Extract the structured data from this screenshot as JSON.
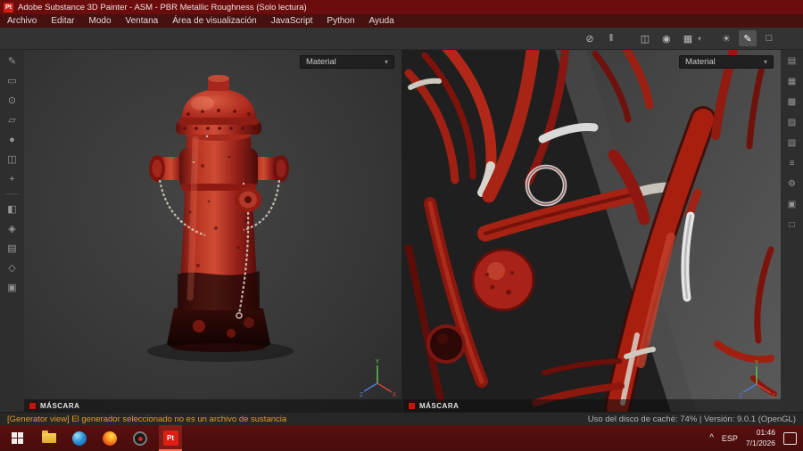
{
  "window": {
    "app_icon": "Pt",
    "title": "Adobe Substance 3D Painter - ASM - PBR Metallic Roughness (Solo lectura)"
  },
  "menubar": {
    "items": [
      "Archivo",
      "Editar",
      "Modo",
      "Ventana",
      "Área de visualización",
      "JavaScript",
      "Python",
      "Ayuda"
    ]
  },
  "top_toolbar": {
    "caret": "▾",
    "icons": [
      {
        "name": "toggle-visibility",
        "glyph": "⊘"
      },
      {
        "name": "pause",
        "glyph": "‖"
      },
      {
        "name": "viewport-layout",
        "glyph": "◫"
      },
      {
        "name": "material-sphere",
        "glyph": "◉"
      },
      {
        "name": "camera-view",
        "glyph": "▦"
      },
      {
        "name": "environment-light",
        "glyph": "☀"
      },
      {
        "name": "paint-mode",
        "glyph": "✎"
      },
      {
        "name": "capture",
        "glyph": "□"
      }
    ]
  },
  "left_toolbar": {
    "tools": [
      "✎",
      "▭",
      "⊙",
      "▱",
      "●",
      "◫",
      "+"
    ],
    "panels": [
      "◧",
      "◈",
      "▤",
      "◇",
      "▣"
    ]
  },
  "right_toolbar": {
    "icons": [
      "▤",
      "▦",
      "▩",
      "▨",
      "▧",
      "≡",
      "⚙",
      "▣",
      "□"
    ]
  },
  "viewport_3d": {
    "material_selector": "Material",
    "mask_label": "MÁSCARA",
    "gizmo": {
      "x": "X",
      "y": "Y",
      "z": "Z"
    }
  },
  "viewport_2d": {
    "material_selector": "Material",
    "mask_label": "MÁSCARA",
    "gizmo": {
      "x": "X",
      "y": "Y",
      "z": "Z"
    }
  },
  "status_bar": {
    "message": "[Generator view] El generador seleccionado no es un archivo de sustancia",
    "cache_info": "Uso del disco de caché:  74% | Versión: 9.0.1 (OpenGL)"
  },
  "taskbar": {
    "tray_expand": "^",
    "language": "ESP",
    "time": "01:46",
    "date": "7/1/2026"
  },
  "colors": {
    "accent_red": "#c0170f",
    "titlebar_red": "#6b0d0d",
    "status_warning": "#e59a28"
  }
}
